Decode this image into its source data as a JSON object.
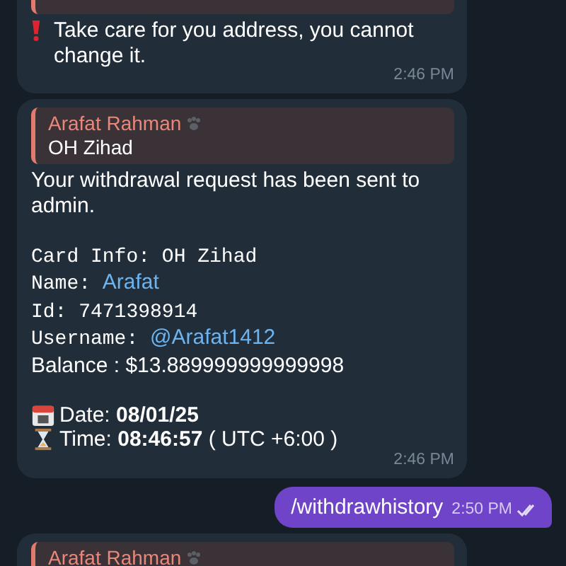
{
  "messages": [
    {
      "kind": "incoming",
      "quoted": true,
      "lines": [
        {
          "kind": "alert",
          "parts": [
            {
              "kind": "plain",
              "text": "Take care for you address, you cannot change it."
            }
          ]
        }
      ],
      "time": "2:46 PM"
    },
    {
      "kind": "incoming",
      "quote": {
        "name": "Arafat Rahman",
        "text": "OH Zihad"
      },
      "lines": [
        {
          "kind": "text",
          "parts": [
            {
              "kind": "plain",
              "text": "Your withdrawal request has been sent to admin."
            }
          ]
        },
        {
          "kind": "blank"
        },
        {
          "kind": "text",
          "parts": [
            {
              "kind": "mono",
              "text": "Card Info: OH Zihad"
            }
          ]
        },
        {
          "kind": "text",
          "parts": [
            {
              "kind": "mono",
              "text": "Name: "
            },
            {
              "kind": "link",
              "text": "Arafat"
            }
          ]
        },
        {
          "kind": "text",
          "parts": [
            {
              "kind": "mono",
              "text": "Id: 7471398914"
            }
          ]
        },
        {
          "kind": "text",
          "parts": [
            {
              "kind": "mono",
              "text": "Username: "
            },
            {
              "kind": "link",
              "text": "@Arafat1412"
            }
          ]
        },
        {
          "kind": "text",
          "parts": [
            {
              "kind": "plain",
              "text": "Balance : $13.889999999999998"
            }
          ]
        },
        {
          "kind": "blank"
        },
        {
          "kind": "calendar",
          "parts": [
            {
              "kind": "plain",
              "text": "Date: **08/01/25**"
            }
          ]
        },
        {
          "kind": "hourglass",
          "parts": [
            {
              "kind": "plain",
              "text": "Time: **08:46:57** ( UTC +6:00 )"
            }
          ]
        }
      ],
      "time": "2:46 PM"
    },
    {
      "kind": "outgoing",
      "lines": [
        {
          "kind": "text",
          "parts": [
            {
              "kind": "plain",
              "text": "/withdrawhistory"
            }
          ]
        }
      ],
      "time": "2:50 PM",
      "read": true
    },
    {
      "kind": "incoming",
      "quote": {
        "name": "Arafat Rahman"
      }
    }
  ]
}
